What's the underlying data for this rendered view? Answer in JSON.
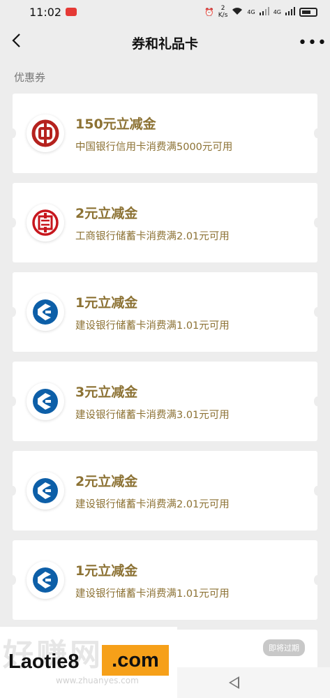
{
  "status": {
    "time": "11:02",
    "speed_value": "2",
    "speed_unit": "K/s",
    "net1": "4G",
    "net2": "4G"
  },
  "header": {
    "title": "券和礼品卡"
  },
  "section": {
    "title": "优惠券"
  },
  "coupons": [
    {
      "amount": "150元立减金",
      "desc": "中国银行信用卡消费满5000元可用",
      "bank_icon": "boc-logo-icon"
    },
    {
      "amount": "2元立减金",
      "desc": "工商银行储蓄卡消费满2.01元可用",
      "bank_icon": "icbc-logo-icon"
    },
    {
      "amount": "1元立减金",
      "desc": "建设银行储蓄卡消费满1.01元可用",
      "bank_icon": "ccb-logo-icon"
    },
    {
      "amount": "3元立减金",
      "desc": "建设银行储蓄卡消费满3.01元可用",
      "bank_icon": "ccb-logo-icon"
    },
    {
      "amount": "2元立减金",
      "desc": "建设银行储蓄卡消费满2.01元可用",
      "bank_icon": "ccb-logo-icon"
    },
    {
      "amount": "1元立减金",
      "desc": "建设银行储蓄卡消费满1.01元可用",
      "bank_icon": "ccb-logo-icon"
    }
  ],
  "partial_card": {
    "badge": "即将过期"
  },
  "watermark": {
    "bg": "好赚网",
    "main": "Laotie8",
    "com": ".com",
    "sub": "www.zhuanyes.com"
  },
  "colors": {
    "accent": "#8c7234",
    "boc_red": "#b5221e",
    "icbc_red": "#c7161d",
    "ccb_blue": "#0d5fa8"
  }
}
